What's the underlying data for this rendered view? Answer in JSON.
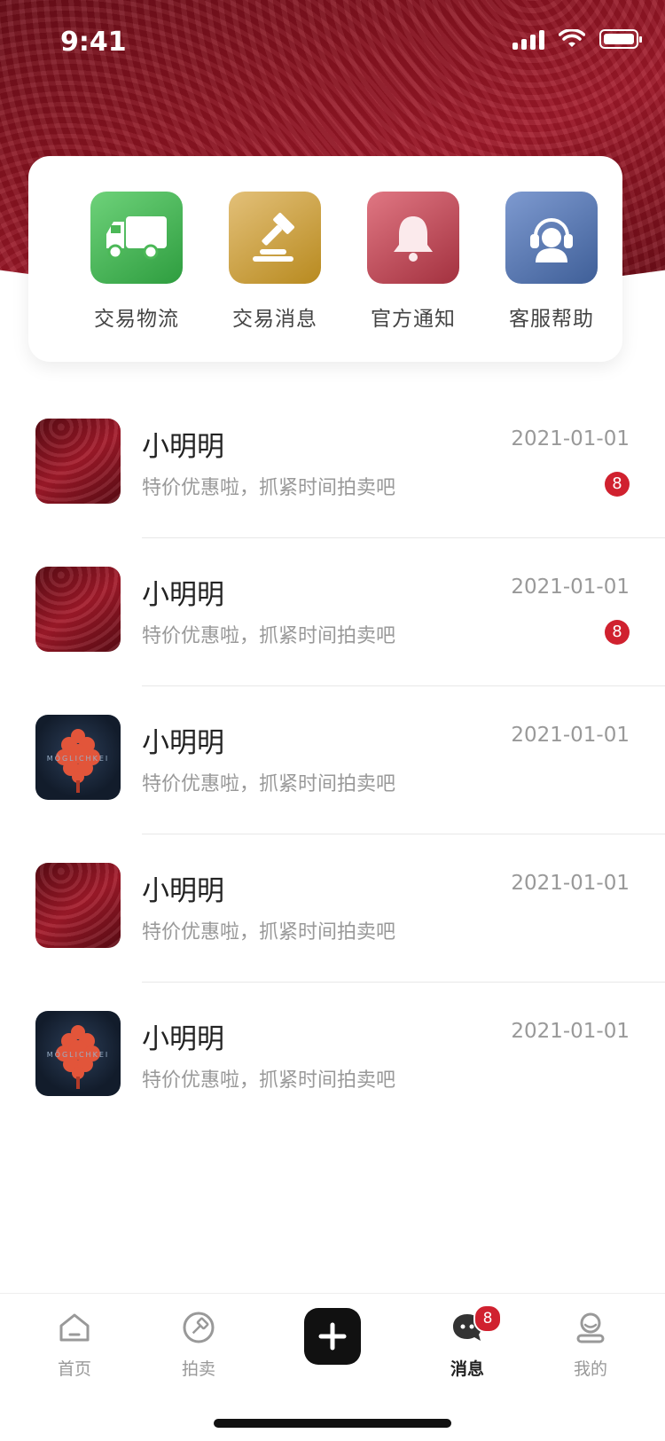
{
  "status_bar": {
    "time": "9:41"
  },
  "quick_actions": [
    {
      "label": "交易物流",
      "icon": "truck-icon",
      "color": "#3FAF4E"
    },
    {
      "label": "交易消息",
      "icon": "gavel-icon",
      "color": "#C9A03D"
    },
    {
      "label": "官方通知",
      "icon": "bell-icon",
      "color": "#B84350"
    },
    {
      "label": "客服帮助",
      "icon": "headset-icon",
      "color": "#4D6FA8"
    }
  ],
  "messages": [
    {
      "name": "小明明",
      "date": "2021-01-01",
      "preview": "特价优惠啦，抓紧时间拍卖吧",
      "badge": "8",
      "avatar": "red-abstract"
    },
    {
      "name": "小明明",
      "date": "2021-01-01",
      "preview": "特价优惠啦，抓紧时间拍卖吧",
      "badge": "8",
      "avatar": "red-abstract"
    },
    {
      "name": "小明明",
      "date": "2021-01-01",
      "preview": "特价优惠啦，抓紧时间拍卖吧",
      "badge": "",
      "avatar": "dark-flower"
    },
    {
      "name": "小明明",
      "date": "2021-01-01",
      "preview": "特价优惠啦，抓紧时间拍卖吧",
      "badge": "",
      "avatar": "red-abstract"
    },
    {
      "name": "小明明",
      "date": "2021-01-01",
      "preview": "特价优惠啦，抓紧时间拍卖吧",
      "badge": "",
      "avatar": "dark-flower"
    }
  ],
  "avatar_watermark": "MÖGLICHKEI",
  "tab_bar": {
    "home": "首页",
    "auction": "拍卖",
    "messages": "消息",
    "messages_badge": "8",
    "mine": "我的",
    "active": "messages"
  },
  "colors": {
    "accent": "#D0212F",
    "hero": "#8E1422"
  }
}
